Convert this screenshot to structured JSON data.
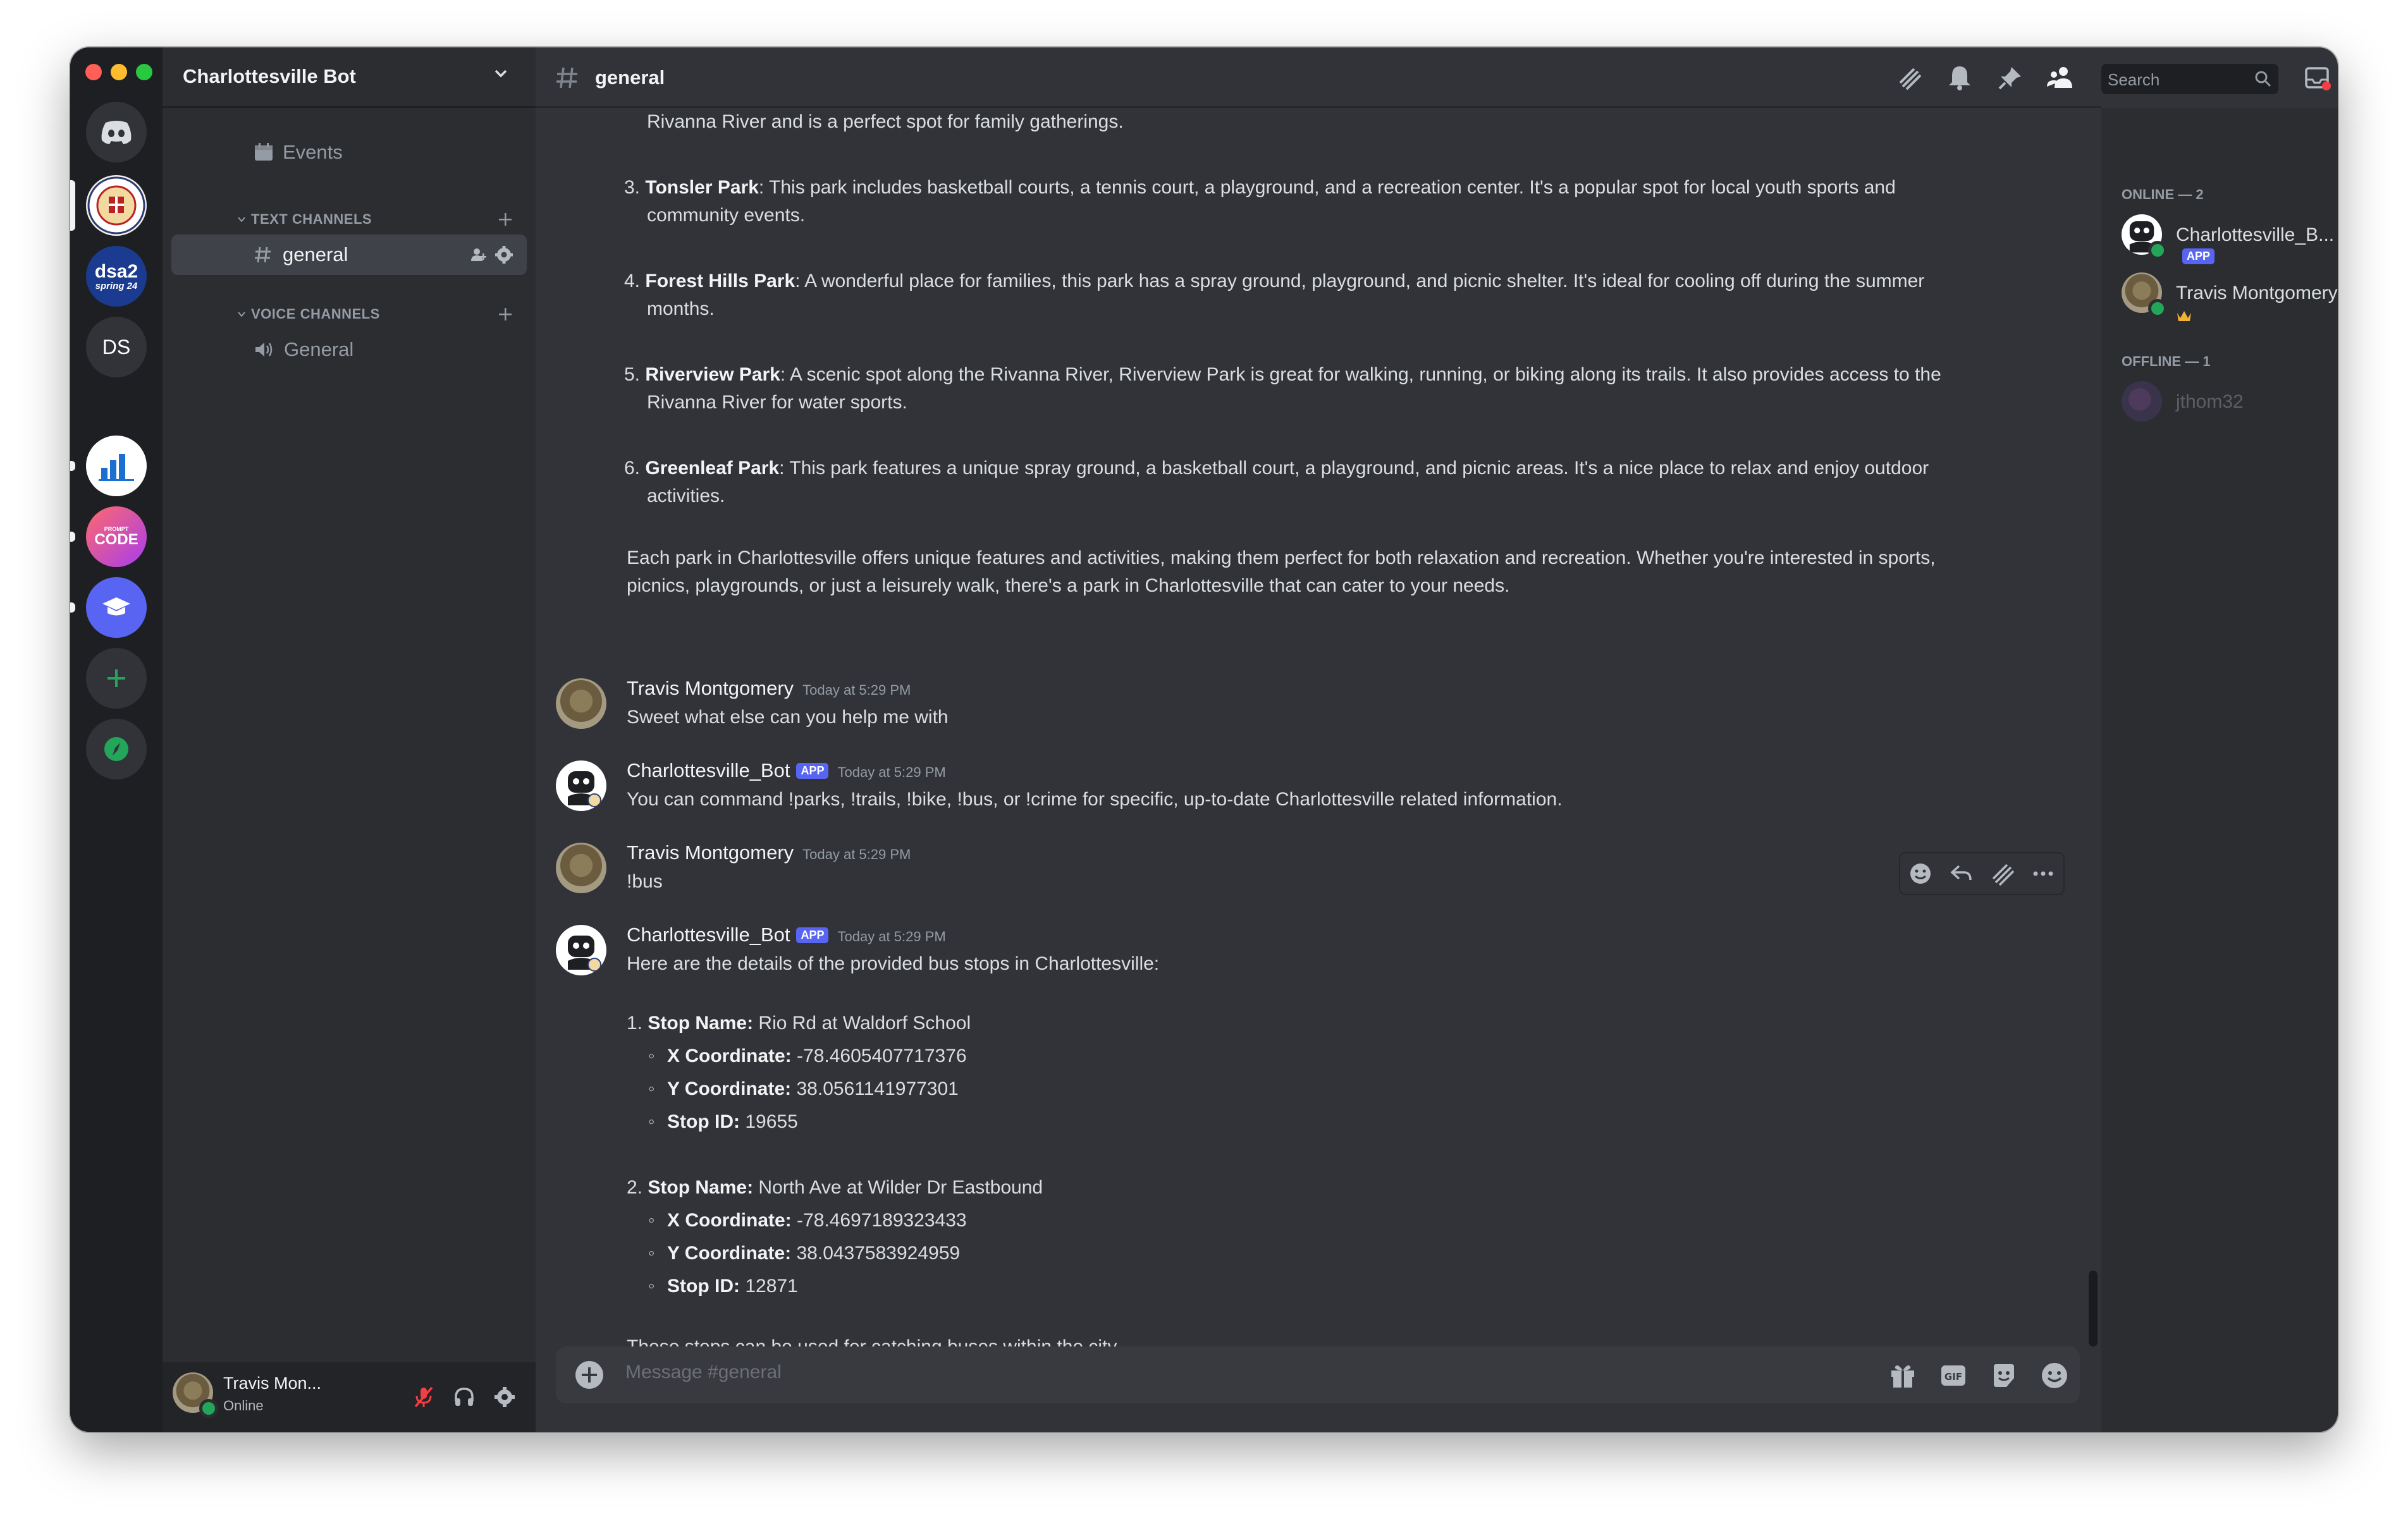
{
  "server_rail": {
    "servers": [
      {
        "name": "discord-home",
        "icon": "discord-logo-icon"
      },
      {
        "name": "charlottesville-seal",
        "icon": "city-seal-icon"
      },
      {
        "name": "dsa2",
        "line1": "dsa2",
        "line2": "spring 24"
      },
      {
        "name": "ds",
        "label": "DS"
      },
      {
        "name": "analytics",
        "icon": "bar-chart-icon"
      },
      {
        "name": "prompt-code",
        "line1": "PROMPT",
        "line2": "CODE"
      },
      {
        "name": "education",
        "icon": "graduation-cap-icon"
      }
    ]
  },
  "sidebar": {
    "server_name": "Charlottesville Bot",
    "events_label": "Events",
    "text_category": "TEXT CHANNELS",
    "voice_category": "VOICE CHANNELS",
    "text_channels": [
      {
        "label": "general"
      }
    ],
    "voice_channels": [
      {
        "label": "General"
      }
    ]
  },
  "user_panel": {
    "name": "Travis Mon...",
    "status": "Online"
  },
  "header": {
    "channel": "general",
    "search_placeholder": "Search"
  },
  "messages": {
    "list_items": [
      {
        "tail": "Rivanna River and is a perfect spot for family gatherings."
      },
      {
        "num": "3.",
        "title": "Tonsler Park",
        "text": ": This park includes basketball courts, a tennis court, a playground, and a recreation center. It's a popular spot for local youth sports and",
        "cont": "community events."
      },
      {
        "num": "4.",
        "title": "Forest Hills Park",
        "text": ": A wonderful place for families, this park has a spray ground, playground, and picnic shelter. It's ideal for cooling off during the summer",
        "cont": "months."
      },
      {
        "num": "5.",
        "title": "Riverview Park",
        "text": ": A scenic spot along the Rivanna River, Riverview Park is great for walking, running, or biking along its trails. It also provides access to the",
        "cont": "Rivanna River for water sports."
      },
      {
        "num": "6.",
        "title": "Greenleaf Park",
        "text": ": This park features a unique spray ground, a basketball court, a playground, and picnic areas. It's a nice place to relax and enjoy outdoor",
        "cont": "activities."
      }
    ],
    "summary_line1": "Each park in Charlottesville offers unique features and activities, making them perfect for both relaxation and recreation. Whether you're interested in sports,",
    "summary_line2": "picnics, playgrounds, or just a leisurely walk, there's a park in Charlottesville that can cater to your needs.",
    "m1": {
      "author": "Travis Montgomery",
      "time": "Today at 5:29 PM",
      "text": "Sweet what else can you help me with"
    },
    "m2": {
      "author": "Charlottesville_Bot",
      "tag": "APP",
      "time": "Today at 5:29 PM",
      "text": "You can command !parks, !trails, !bike, !bus, or !crime for specific, up-to-date Charlottesville related information."
    },
    "m3": {
      "author": "Travis Montgomery",
      "time": "Today at 5:29 PM",
      "text": "!bus"
    },
    "m4": {
      "author": "Charlottesville_Bot",
      "tag": "APP",
      "time": "Today at 5:29 PM",
      "intro": "Here are the details of the provided bus stops in Charlottesville:",
      "stops": [
        {
          "num": "1.",
          "name_label": "Stop Name:",
          "name": "Rio Rd at Waldorf School",
          "x_label": "X Coordinate:",
          "x": "-78.4605407717376",
          "y_label": "Y Coordinate:",
          "y": "38.0561141977301",
          "id_label": "Stop ID:",
          "id": "19655"
        },
        {
          "num": "2.",
          "name_label": "Stop Name:",
          "name": "North Ave at Wilder Dr Eastbound",
          "x_label": "X Coordinate:",
          "x": "-78.4697189323433",
          "y_label": "Y Coordinate:",
          "y": "38.0437583924959",
          "id_label": "Stop ID:",
          "id": "12871"
        }
      ],
      "outro": "These stops can be used for catching buses within the city."
    }
  },
  "composer": {
    "placeholder": "Message #general"
  },
  "members": {
    "online_header": "ONLINE — 2",
    "offline_header": "OFFLINE — 1",
    "online": [
      {
        "name": "Charlottesville_B...",
        "tag": "APP"
      },
      {
        "name": "Travis Montgomery"
      }
    ],
    "offline": [
      {
        "name": "jthom32"
      }
    ]
  },
  "colors": {
    "accent": "#5865f2",
    "online": "#23a55a",
    "background": "#313338",
    "sidebar": "#2b2d31",
    "rail": "#1e1f22"
  }
}
